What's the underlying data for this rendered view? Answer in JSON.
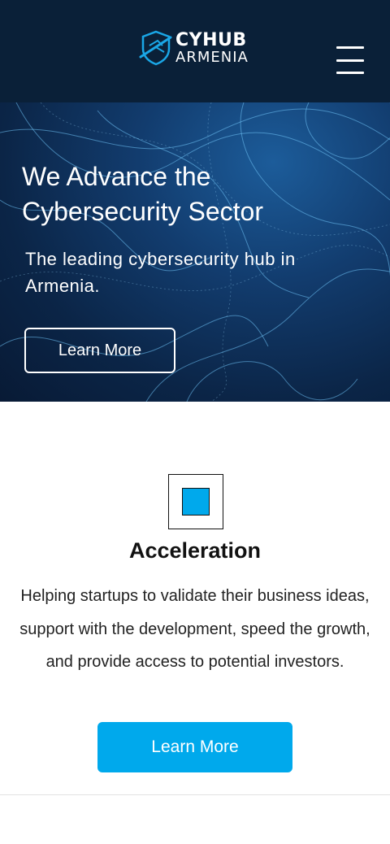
{
  "header": {
    "logo": {
      "line1": "CYHUB",
      "line2": "ARMENIA"
    },
    "menu_icon": "hamburger-menu-icon"
  },
  "hero": {
    "title": "We Advance the Cybersecurity Sector",
    "subtitle": "The leading cybersecurity hub in Armenia.",
    "button_label": "Learn More"
  },
  "feature": {
    "icon": "square-icon",
    "title": "Acceleration",
    "description": "Helping startups to validate their business ideas, support with the development, speed the growth, and provide access to potential investors.",
    "button_label": "Learn More"
  },
  "colors": {
    "header_bg": "#0a2038",
    "accent": "#00a9ec",
    "white": "#ffffff"
  }
}
